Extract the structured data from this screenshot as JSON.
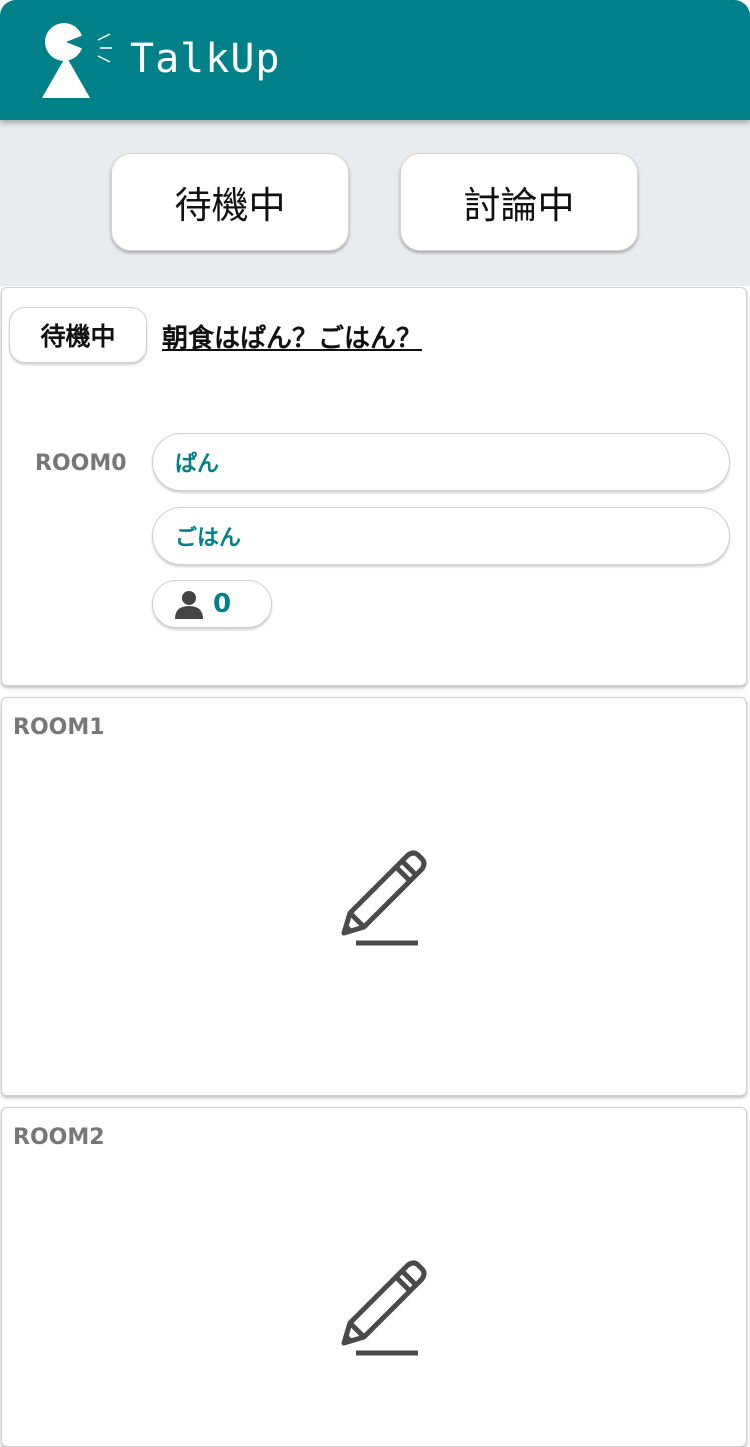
{
  "header": {
    "title": "TalkUp",
    "logo_icon": "speaking-person-icon",
    "bg_color": "#00818a"
  },
  "tabs": [
    {
      "label": "待機中"
    },
    {
      "label": "討論中"
    }
  ],
  "rooms": [
    {
      "label": "ROOM0",
      "status": "待機中",
      "topic": "朝食はぱん？ごはん？",
      "options": [
        "ぱん",
        "ごはん"
      ],
      "participant_icon": "user-icon",
      "participants": "0"
    },
    {
      "label": "ROOM1",
      "action_icon": "pencil-icon"
    },
    {
      "label": "ROOM2",
      "action_icon": "pencil-icon"
    }
  ],
  "colors": {
    "accent": "#00818a",
    "toolbar_bg": "#e9ecef",
    "muted_text": "#777777"
  }
}
